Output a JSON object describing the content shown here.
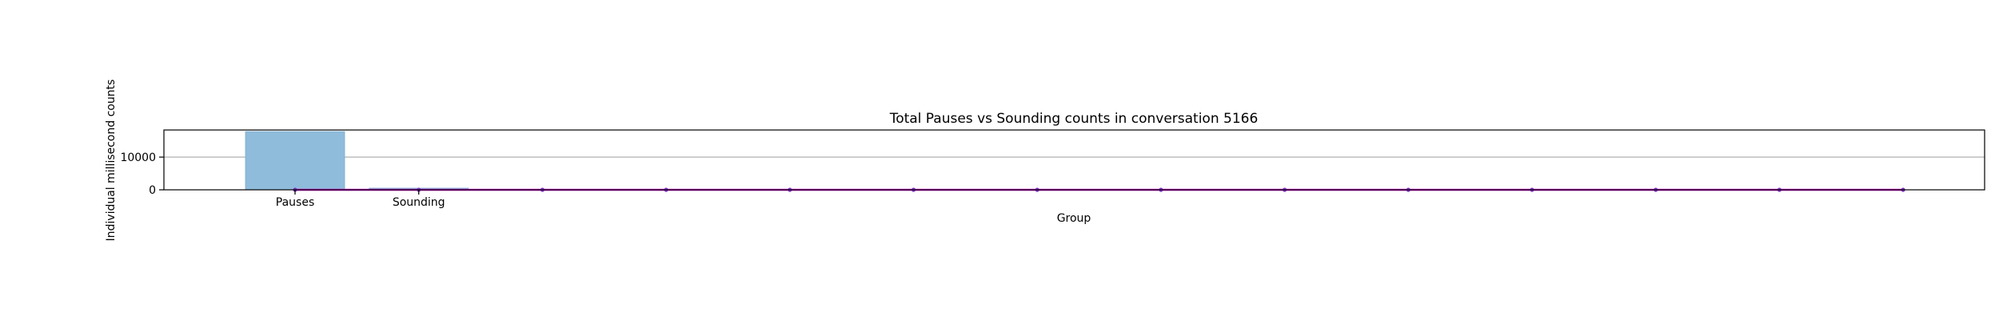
{
  "chart_data": {
    "type": "bar",
    "title": "Total Pauses vs Sounding counts in conversation 5166",
    "xlabel": "Group",
    "ylabel": "Individual millisecond counts",
    "categories": [
      "Pauses",
      "Sounding"
    ],
    "values": [
      17800,
      500
    ],
    "yticks": [
      0,
      10000
    ],
    "ylim": [
      0,
      18300
    ],
    "grid": "y",
    "colors": {
      "bar": "#8fbcdb",
      "bar_edge": "#7aaed1",
      "line": "#cc00cc",
      "marker": "#7b2fbe",
      "grid": "#b0b0b0",
      "axis": "#000000"
    },
    "overlay_line": {
      "x": [
        0,
        1,
        2,
        3,
        4,
        5,
        6,
        7,
        8,
        9,
        10,
        11,
        12,
        13
      ],
      "values": [
        0,
        0,
        0,
        0,
        0,
        0,
        0,
        0,
        0,
        0,
        0,
        0,
        0,
        0
      ]
    }
  }
}
